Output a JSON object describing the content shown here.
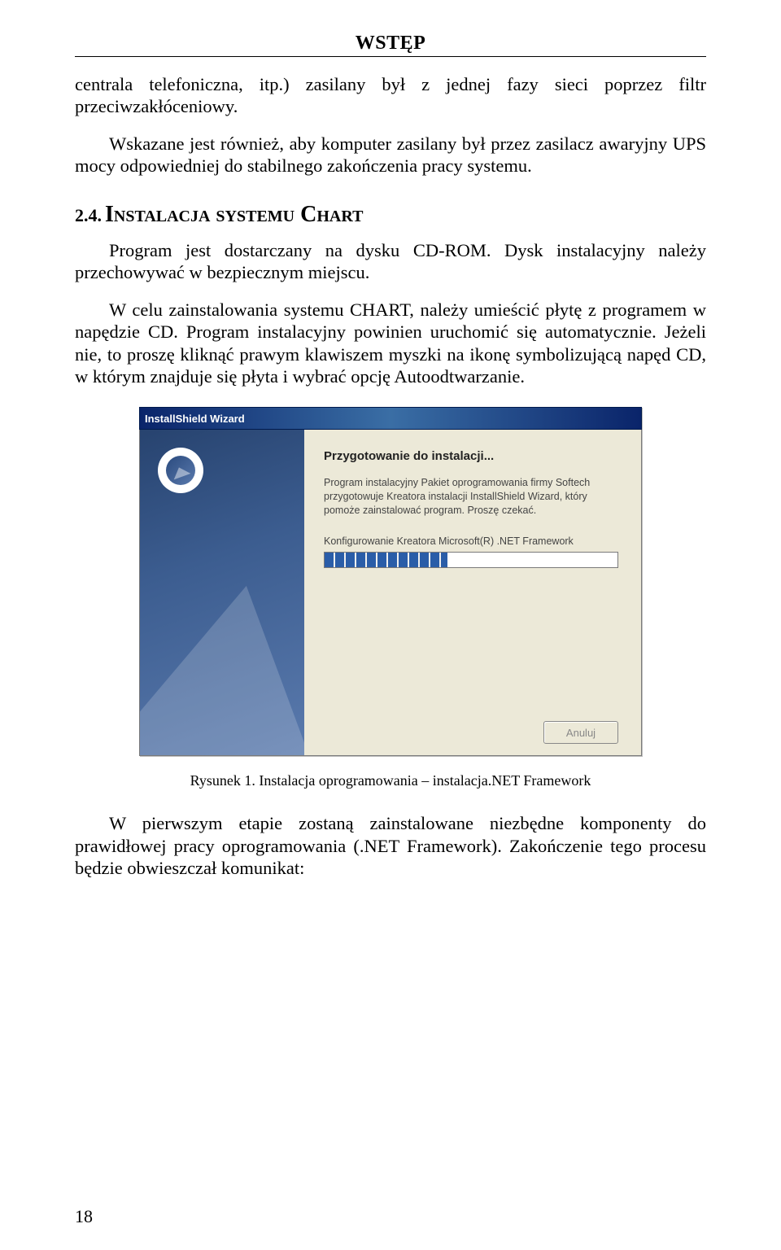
{
  "header": "WSTĘP",
  "p1": "centrala telefoniczna, itp.) zasilany był z jednej fazy sieci poprzez filtr przeciwzakłóceniowy.",
  "p2": "Wskazane jest również, aby komputer zasilany był przez zasilacz awaryjny UPS mocy odpowiedniej do stabilnego zakończenia pracy systemu.",
  "section_num": "2.4.",
  "section_title": "Instalacja systemu Chart",
  "p3": "Program jest dostarczany na dysku CD-ROM. Dysk instalacyjny należy przechowywać w bezpiecznym miejscu.",
  "p4": "W celu zainstalowania systemu CHART, należy umieścić płytę z programem w napędzie CD. Program instalacyjny powinien uruchomić się automatycznie. Jeżeli nie, to proszę kliknąć prawym klawiszem myszki na ikonę symbolizującą napęd CD, w którym znajduje się płyta i wybrać opcję Autoodtwarzanie.",
  "dialog": {
    "title": "InstallShield Wizard",
    "heading": "Przygotowanie do instalacji...",
    "desc": "Program instalacyjny Pakiet oprogramowania firmy Softech przygotowuje Kreatora instalacji InstallShield Wizard, który pomoże zainstalować program. Proszę czekać.",
    "status": "Konfigurowanie Kreatora Microsoft(R) .NET Framework",
    "progress_percent": 42,
    "cancel": "Anuluj"
  },
  "caption": "Rysunek 1. Instalacja oprogramowania – instalacja.NET Framework",
  "p5": "W pierwszym etapie zostaną zainstalowane niezbędne komponenty do prawidłowej pracy oprogramowania (.NET Framework). Zakończenie tego procesu będzie obwieszczał komunikat:",
  "pagenum": "18"
}
